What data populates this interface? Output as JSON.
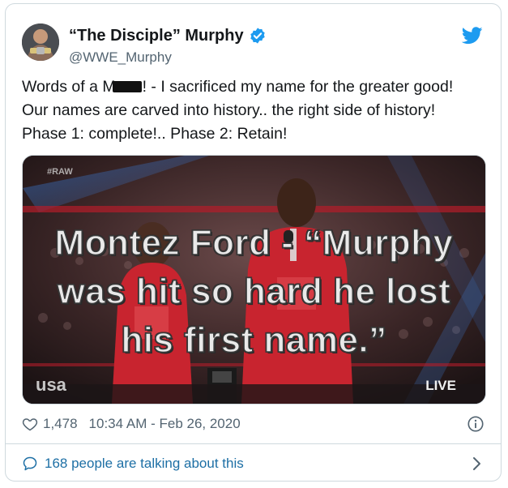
{
  "author": {
    "display_name": "“The Disciple” Murphy",
    "handle": "@WWE_Murphy",
    "verified": true
  },
  "tweet": {
    "line1_before_censor": "Words of a M",
    "line1_after_censor": "! - I sacrificed my name for the greater good!",
    "line2": "Our names are carved into history.. the right side of history!",
    "line3": "Phase 1: complete!.. Phase 2: Retain!"
  },
  "media": {
    "caption_line1": "Montez Ford - “Murphy",
    "caption_line2": "was hit so hard he lost",
    "caption_line3": "his first name.”",
    "watermark_raw": "#RAW",
    "network_logo": "usa",
    "live_bug": "LIVE"
  },
  "meta": {
    "likes": "1,478",
    "timestamp": "10:34 AM - Feb 26, 2020"
  },
  "footer": {
    "talking": "168 people are talking about this"
  },
  "colors": {
    "twitter_blue": "#1d9bf0",
    "link_blue": "#1d6fa5",
    "muted_text": "#536471",
    "border": "#cfd9de"
  },
  "icons": {
    "verified": "verified-badge-icon",
    "logo": "twitter-bird-icon",
    "like": "heart-icon",
    "info": "info-icon",
    "replies": "chat-bubble-icon",
    "more": "chevron-right-icon"
  }
}
